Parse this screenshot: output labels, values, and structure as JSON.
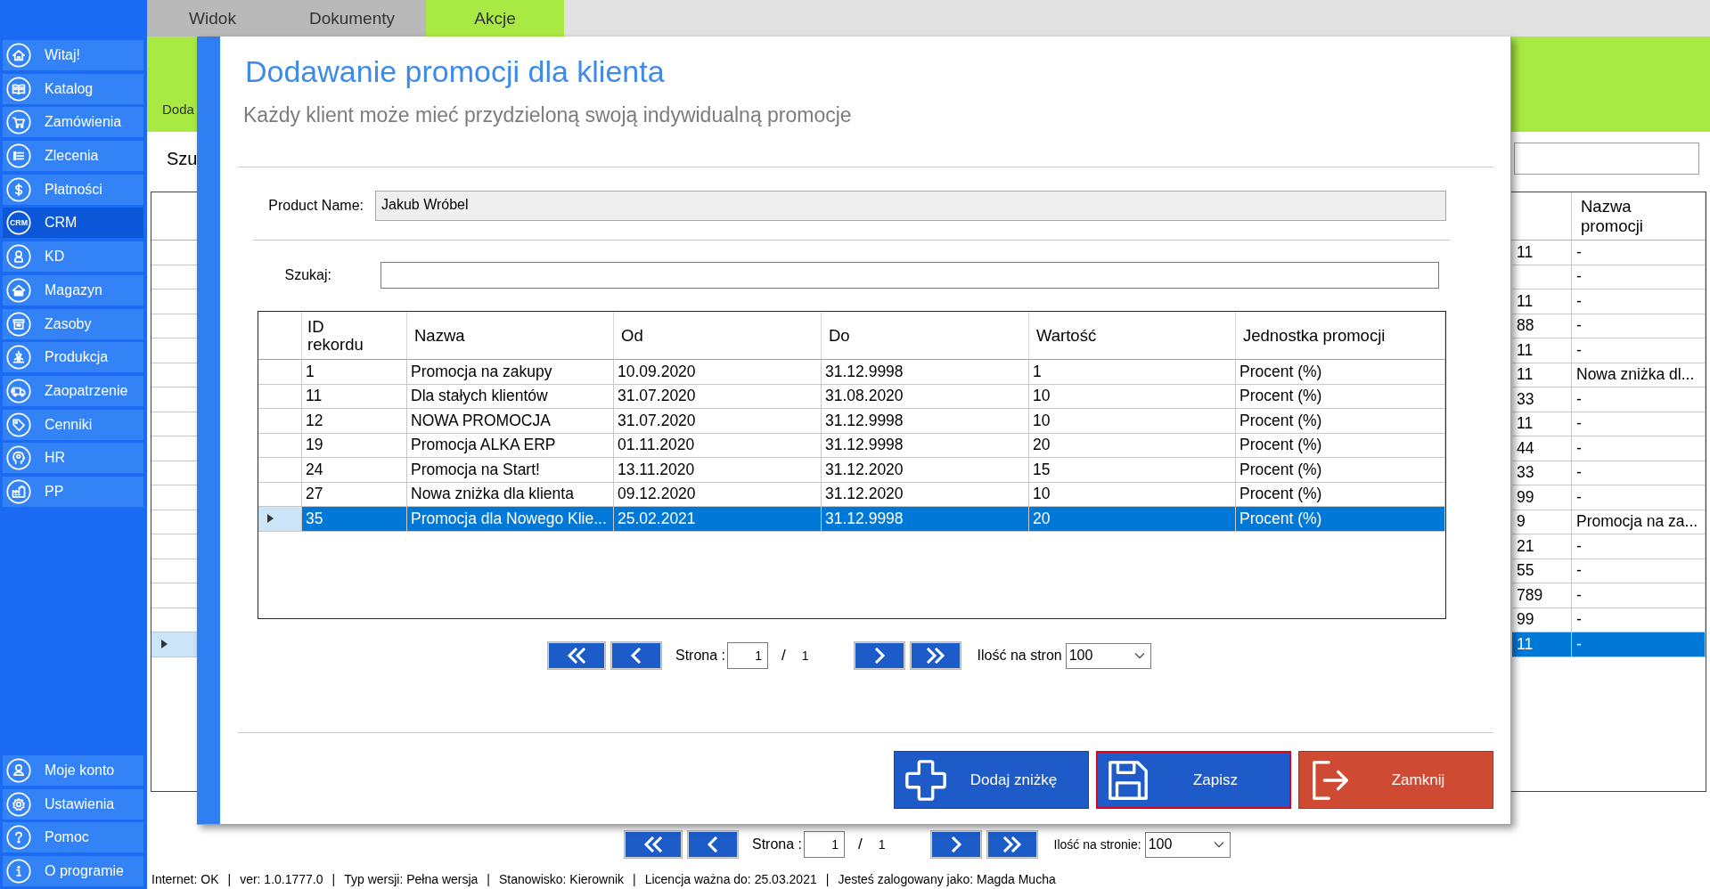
{
  "menu_tabs": [
    {
      "label": "Widok",
      "selected": false
    },
    {
      "label": "Dokumenty",
      "selected": false
    },
    {
      "label": "Akcje",
      "selected": true
    }
  ],
  "sidebar": {
    "items": [
      {
        "label": "Witaj!",
        "selected": false
      },
      {
        "label": "Katalog",
        "selected": false
      },
      {
        "label": "Zamówienia",
        "selected": false
      },
      {
        "label": "Zlecenia",
        "selected": false
      },
      {
        "label": "Płatności",
        "selected": false
      },
      {
        "label": "CRM",
        "selected": true,
        "icon_text": "CRM"
      },
      {
        "label": "KD",
        "selected": false
      },
      {
        "label": "Magazyn",
        "selected": false
      },
      {
        "label": "Zasoby",
        "selected": false
      },
      {
        "label": "Produkcja",
        "selected": false
      },
      {
        "label": "Zaopatrzenie",
        "selected": false
      },
      {
        "label": "Cenniki",
        "selected": false
      },
      {
        "label": "HR",
        "selected": false
      },
      {
        "label": "PP",
        "selected": false
      }
    ],
    "bottom_items": [
      {
        "label": "Moje konto",
        "selected": false
      },
      {
        "label": "Ustawienia",
        "selected": false
      },
      {
        "label": "Pomoc",
        "selected": false
      },
      {
        "label": "O programie",
        "selected": false
      }
    ]
  },
  "background_page": {
    "ribbon_text": "Doda",
    "search_label": "Szu",
    "table": {
      "header": "Nazwa promocji",
      "rows": [
        {
          "column_1": "11",
          "nazwa_promocji": "-",
          "selected": false
        },
        {
          "nazwa_promocji": "-",
          "selected": false
        },
        {
          "column_1": "11",
          "nazwa_promocji": "-",
          "selected": false
        },
        {
          "column_1": "88",
          "nazwa_promocji": "-",
          "selected": false
        },
        {
          "column_1": "11",
          "nazwa_promocji": "-",
          "selected": false
        },
        {
          "column_1": "11",
          "nazwa_promocji": "Nowa zniżka dl...",
          "selected": false
        },
        {
          "column_1": "33",
          "nazwa_promocji": "-",
          "selected": false
        },
        {
          "column_1": "11",
          "nazwa_promocji": "-",
          "selected": false
        },
        {
          "column_1": "44",
          "nazwa_promocji": "-",
          "selected": false
        },
        {
          "column_1": "33",
          "nazwa_promocji": "-",
          "selected": false
        },
        {
          "column_1": "99",
          "nazwa_promocji": "-",
          "selected": false
        },
        {
          "column_1": "9",
          "nazwa_promocji": "Promocja na za...",
          "selected": false
        },
        {
          "column_1": "21",
          "nazwa_promocji": "-",
          "selected": false
        },
        {
          "column_1": "55",
          "nazwa_promocji": "-",
          "selected": false
        },
        {
          "column_1": "789",
          "nazwa_promocji": "-",
          "selected": false
        },
        {
          "column_1": "99",
          "nazwa_promocji": "-",
          "selected": false
        },
        {
          "column_1": "11",
          "nazwa_promocji": "-",
          "selected": true
        }
      ]
    },
    "pagination": {
      "page_label": "Strona :",
      "page": "1",
      "separator": "/",
      "total": "1",
      "per_page_label": "Ilość na stronie:",
      "per_page": "100"
    }
  },
  "dialog": {
    "title": "Dodawanie promocji dla klienta",
    "subtitle": "Każdy klient może mieć przydzieloną swoją indywidualną promocje",
    "product_name": {
      "label": "Product Name:",
      "value": "Jakub Wróbel"
    },
    "search": {
      "label": "Szukaj:"
    },
    "table": {
      "columns": [
        "ID rekordu",
        "Nazwa",
        "Od",
        "Do",
        "Wartość",
        "Jednostka promocji"
      ],
      "rows": [
        {
          "cells": [
            "1",
            "Promocja na zakupy",
            "10.09.2020",
            "31.12.9998",
            "1",
            "Procent (%)"
          ],
          "selected": false
        },
        {
          "cells": [
            "11",
            "Dla stałych klientów",
            "31.07.2020",
            "31.08.2020",
            "10",
            "Procent (%)"
          ],
          "selected": false
        },
        {
          "cells": [
            "12",
            "NOWA PROMOCJA",
            "31.07.2020",
            "31.12.9998",
            "10",
            "Procent (%)"
          ],
          "selected": false
        },
        {
          "cells": [
            "19",
            "Promocja ALKA ERP",
            "01.11.2020",
            "31.12.9998",
            "20",
            "Procent (%)"
          ],
          "selected": false
        },
        {
          "cells": [
            "24",
            "Promocja na Start!",
            "13.11.2020",
            "31.12.2020",
            "15",
            "Procent (%)"
          ],
          "selected": false
        },
        {
          "cells": [
            "27",
            "Nowa zniżka dla klienta",
            "09.12.2020",
            "31.12.2020",
            "10",
            "Procent (%)"
          ],
          "selected": false
        },
        {
          "cells": [
            "35",
            "Promocja dla Nowego Klie...",
            "25.02.2021",
            "31.12.9998",
            "20",
            "Procent (%)"
          ],
          "selected": true
        }
      ]
    },
    "pagination": {
      "page_label": "Strona :",
      "page": "1",
      "separator": "/",
      "total": "1",
      "per_page_label": "Ilość na stron",
      "per_page": "100"
    },
    "buttons": [
      {
        "label": "Dodaj zniżkę",
        "kind": "add",
        "focused": false
      },
      {
        "label": "Zapisz",
        "kind": "save",
        "focused": true
      },
      {
        "label": "Zamknij",
        "kind": "close",
        "focused": false
      }
    ]
  },
  "status_bar": {
    "separator": "|",
    "items": [
      "Internet: OK",
      "ver: 1.0.1777.0",
      "Typ wersji: Pełna wersja",
      "Stanowisko: Kierownik",
      "Licencja ważna do: 25.03.2021",
      "Jesteś zalogowany jako: Magda Mucha"
    ]
  }
}
